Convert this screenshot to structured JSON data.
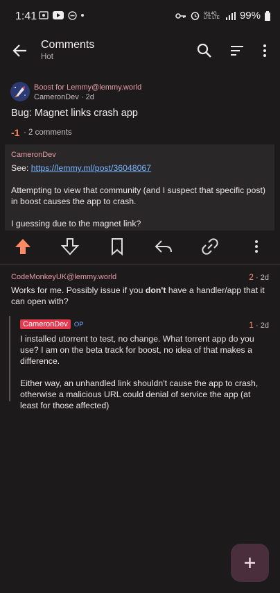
{
  "status_bar": {
    "time": "1:41",
    "battery": "99%",
    "signal_lines": "Vo) 4G LTE LTE"
  },
  "app_bar": {
    "title": "Comments",
    "subtitle": "Hot"
  },
  "post": {
    "community": "Boost for Lemmy@lemmy.world",
    "author_time": "CameronDev · 2d",
    "title": "Bug: Magnet links crash app",
    "score": "-1",
    "comments": "2 comments",
    "body_author": "CameronDev",
    "body_see": "See: ",
    "body_link": "https://lemmy.ml/post/36048067",
    "body_p2": "Attempting to view that community (and I suspect that specific post) in boost causes the app to crash.",
    "body_p3": "I guessing due to the magnet link?"
  },
  "comment1": {
    "author": "CodeMonkeyUK@lemmy.world",
    "score": "2",
    "time": " · 2d",
    "text_before": "Works for me. Possibly issue if you ",
    "text_bold": "don't",
    "text_after": " have a handler/app that it can open with?"
  },
  "comment2": {
    "author": "CameronDev",
    "op_tag": "OP",
    "score": "1",
    "time": " · 2d",
    "p1": "I installed utorrent to test, no change. What torrent app do you use? I am on the beta track for boost, no idea of that makes a difference.",
    "p2": "Either way, an unhandled link shouldn't cause the app to crash, otherwise a malicious URL could denial of service the app (at least for those affected)"
  },
  "colors": {
    "accent": "#e79da8",
    "upvote": "#ff8a65",
    "link": "#7ab4ff",
    "op_badge": "#e53950"
  }
}
